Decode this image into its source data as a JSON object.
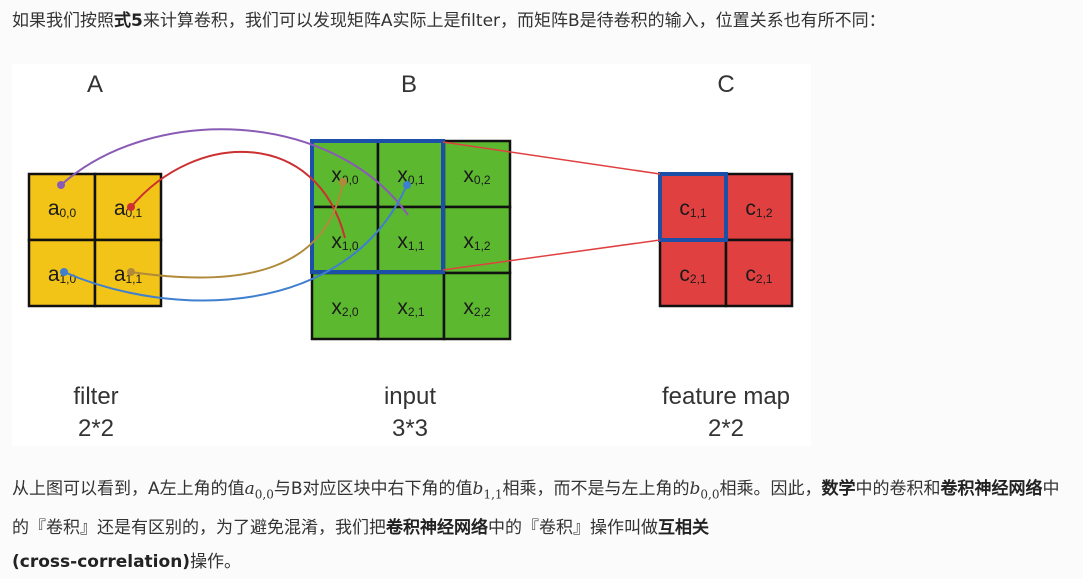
{
  "intro": {
    "part1": "如果我们按照",
    "bold": "式5",
    "part2": "来计算卷积，我们可以发现矩阵A实际上是filter，而矩阵B是待卷积的输入，位置关系也有所不同："
  },
  "figure": {
    "header_a": "A",
    "header_b": "B",
    "header_c": "C",
    "matrix_a": [
      [
        "a0,0",
        "a0,1"
      ],
      [
        "a1,0",
        "a1,1"
      ]
    ],
    "matrix_b": [
      [
        "x0,0",
        "x0,1",
        "x0,2"
      ],
      [
        "x1,0",
        "x1,1",
        "x1,2"
      ],
      [
        "x2,0",
        "x2,1",
        "x2,2"
      ]
    ],
    "matrix_c": [
      [
        "c1,1",
        "c1,2"
      ],
      [
        "c2,1",
        "c2,1"
      ]
    ],
    "caption_a_name": "filter",
    "caption_a_size": "2*2",
    "caption_b_name": "input",
    "caption_b_size": "3*3",
    "caption_c_name": "feature map",
    "caption_c_size": "2*2",
    "colors": {
      "filter_fill": "#f2c418",
      "input_fill": "#5cb82f",
      "output_fill": "#e04040",
      "highlight": "#1b4fa8",
      "curve_purple": "#8a5bb5",
      "curve_red": "#cc3030",
      "curve_brown": "#b08a3a",
      "curve_blue": "#3f7fd0"
    }
  },
  "explanation": {
    "t1": "从上图可以看到，A左上角的值",
    "m1_base": "a",
    "m1_sub": "0,0",
    "t2": "与B对应区块中右下角的值",
    "m2_base": "b",
    "m2_sub": "1,1",
    "t3": "相乘，而不是与左上角的",
    "m3_base": "b",
    "m3_sub": "0,0",
    "t4": "相乘。因此，",
    "b1": "数学",
    "t5": "中的卷积和",
    "b2": "卷积神经网络",
    "t6": "中的『卷积』还是有区别的，为了避免混淆，我们把",
    "b3": "卷积神经网络",
    "t7": "中的『卷积』操作叫做",
    "b4": "互相关",
    "b5": "(cross-correlation)",
    "t8": "操作。"
  }
}
